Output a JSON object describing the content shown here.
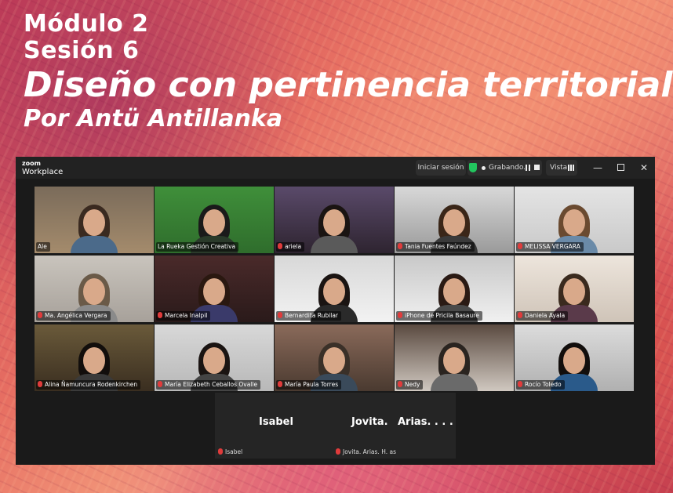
{
  "header": {
    "module": "Módulo 2",
    "session": "Sesión 6",
    "title": "Diseño con pertinencia territorial",
    "author": "Por Antü Antillanka"
  },
  "zoom": {
    "logo_top": "zoom",
    "logo_bottom": "Workplace",
    "signin": "Iniciar sesión",
    "recording": "Grabando...",
    "view": "Vista",
    "minimize": "—",
    "close": "✕",
    "active_speaker_color": "#3fbf4f",
    "muted_mic_color": "#e03b3b"
  },
  "participants": [
    {
      "name": "Ale",
      "muted": false
    },
    {
      "name": "La Rueka Gestión Creativa",
      "muted": false
    },
    {
      "name": "ariela",
      "muted": true
    },
    {
      "name": "Tania Fuentes Faúndez",
      "muted": true
    },
    {
      "name": "MELISSA VERGARA",
      "muted": true
    },
    {
      "name": "Ma. Angélica Vergara",
      "muted": true
    },
    {
      "name": "Marcela Inalpil",
      "muted": true
    },
    {
      "name": "Bernardita Rubilar",
      "muted": true
    },
    {
      "name": "iPhone de Pricila Basaure",
      "muted": true
    },
    {
      "name": "Daniela Ayala",
      "muted": true
    },
    {
      "name": "Alina Ñamuncura Rodenkirchen",
      "muted": true
    },
    {
      "name": "María Elizabeth Ceballos Ovalle",
      "muted": true
    },
    {
      "name": "María Paula Torres",
      "muted": true
    },
    {
      "name": "Nedy",
      "muted": true
    },
    {
      "name": "Rocío Toledo",
      "muted": true
    }
  ],
  "no_video": {
    "isabel_center": "Isabel",
    "jovita_center": "Jovita.",
    "arias_center": "Arias. . . .",
    "isabel_label": "Isabel",
    "jovita_label": "Jovita.   Arias.    H.    as"
  }
}
